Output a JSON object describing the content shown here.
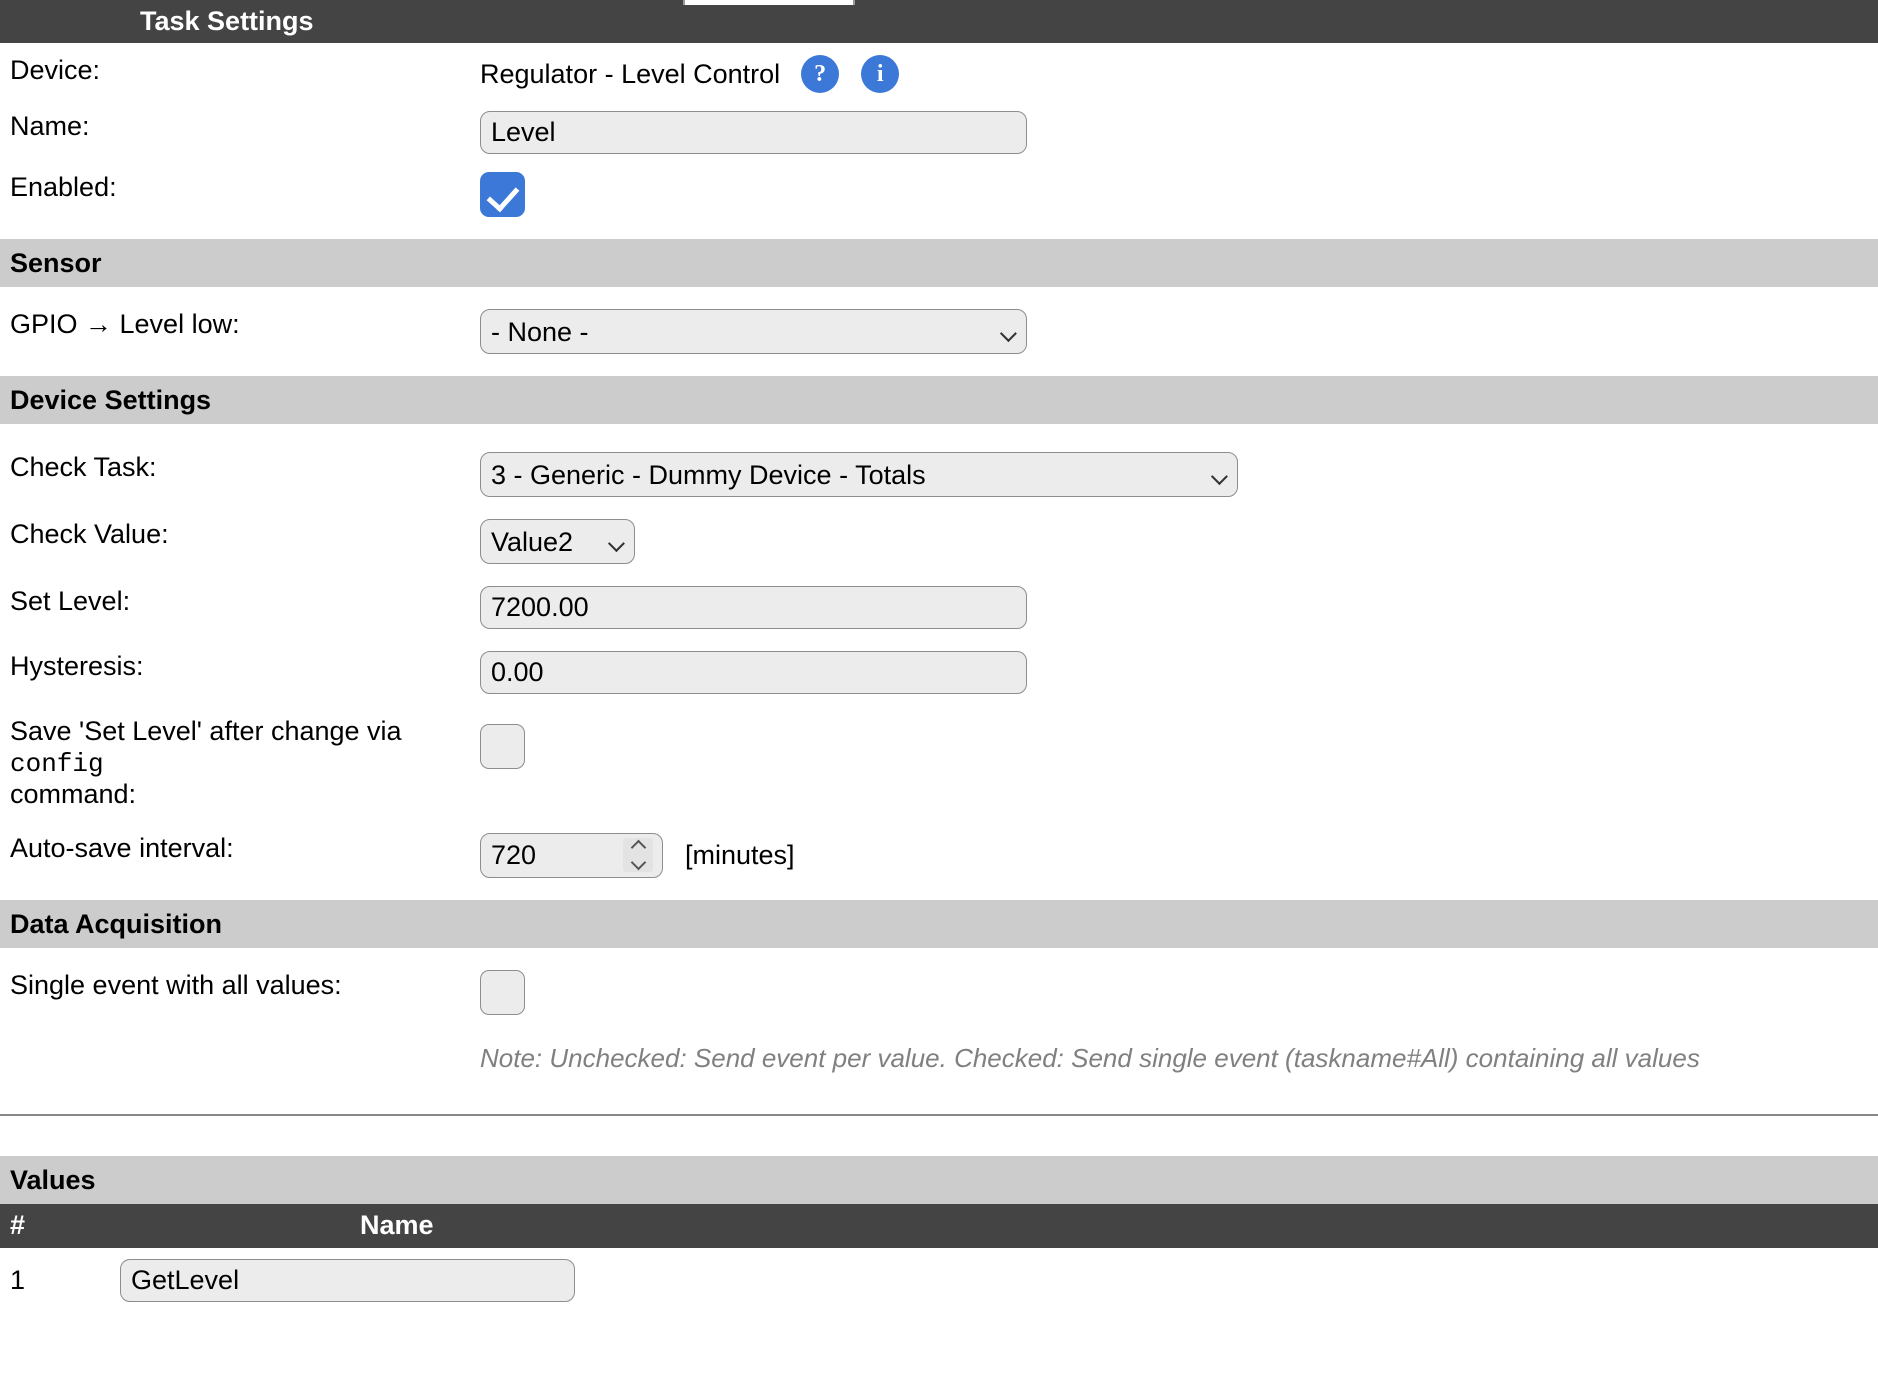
{
  "header": {
    "title": "Task Settings"
  },
  "task": {
    "device_label": "Device:",
    "device_value": "Regulator - Level Control",
    "help_icon": "?",
    "info_icon": "i",
    "name_label": "Name:",
    "name_value": "Level",
    "enabled_label": "Enabled:",
    "enabled_checked": true
  },
  "sensor": {
    "section_title": "Sensor",
    "gpio_label": "GPIO → Level low:",
    "gpio_value": "- None -"
  },
  "device_settings": {
    "section_title": "Device Settings",
    "check_task_label": "Check Task:",
    "check_task_value": "3 - Generic - Dummy Device - Totals",
    "check_value_label": "Check Value:",
    "check_value_value": "Value2",
    "set_level_label": "Set Level:",
    "set_level_value": "7200.00",
    "hysteresis_label": "Hysteresis:",
    "hysteresis_value": "0.00",
    "save_setlevel_label_1": "Save 'Set Level' after change via",
    "save_setlevel_label_mono": "config",
    "save_setlevel_label_2": "command:",
    "save_setlevel_checked": false,
    "autosave_label": "Auto-save interval:",
    "autosave_value": "720",
    "autosave_unit": "[minutes]"
  },
  "data_acquisition": {
    "section_title": "Data Acquisition",
    "single_event_label": "Single event with all values:",
    "single_event_checked": false,
    "note": "Note: Unchecked: Send event per value. Checked: Send single event (taskname#All) containing all values"
  },
  "values": {
    "section_title": "Values",
    "columns": {
      "index": "#",
      "name": "Name"
    },
    "rows": [
      {
        "index": "1",
        "name": "GetLevel"
      }
    ]
  },
  "colors": {
    "bar_dark": "#444444",
    "bar_grey": "#cccccc",
    "accent_blue": "#3b78d8",
    "field_bg": "#ececec",
    "note_grey": "#808080"
  }
}
